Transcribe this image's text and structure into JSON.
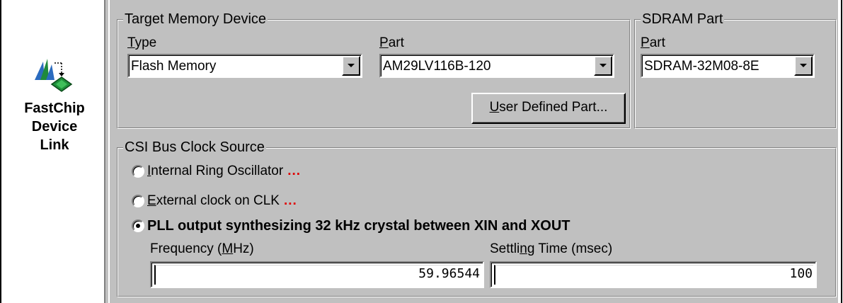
{
  "app": {
    "caption_line1": "FastChip",
    "caption_line2": "Device",
    "caption_line3": "Link",
    "logo_icon": "fastchip-device-link-icon"
  },
  "target_memory": {
    "title": "Target Memory Device",
    "type_label_accel": "T",
    "type_label_rest": "ype",
    "type_value": "Flash Memory",
    "part_label_accel": "P",
    "part_label_rest": "art",
    "part_value": "AM29LV116B-120",
    "user_defined_button_accel": "U",
    "user_defined_button_rest": "ser Defined Part..."
  },
  "sdram": {
    "title": "SDRAM Part",
    "part_label_rest": "Part",
    "part_value": "SDRAM-32M08-8E"
  },
  "clock_source": {
    "title": "CSI Bus Clock Source",
    "options": [
      {
        "accel": "I",
        "rest": "nternal Ring Oscillator",
        "dots": "...",
        "selected": false
      },
      {
        "accel": "E",
        "rest": "xternal clock on CLK",
        "dots": "...",
        "selected": false
      },
      {
        "accel": "",
        "rest": "PLL output synthesizing 32 kHz crystal between XIN and XOUT",
        "dots": "",
        "selected": true
      }
    ],
    "frequency_label_pre": "Frequency (",
    "frequency_label_accel": "M",
    "frequency_label_post": "Hz)",
    "frequency_value": "59.96544",
    "settling_label_pre": "Settli",
    "settling_label_accel": "n",
    "settling_label_post": "g Time (msec)",
    "settling_value": "100"
  },
  "colors": {
    "dialog_bg": "#c0c0c0",
    "dots_red": "#e00000"
  }
}
